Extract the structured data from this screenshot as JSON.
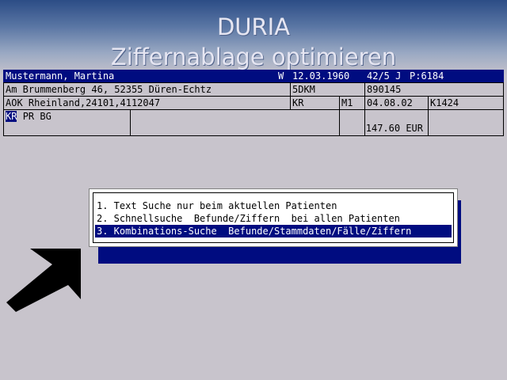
{
  "banner": {
    "app_name": "DURIA",
    "subtitle": "Ziffernablage optimieren"
  },
  "patient": {
    "name": "Mustermann, Martina",
    "sex": "W",
    "birthdate": "12.03.1960",
    "age": "42/5 J",
    "patient_no": "P:6184",
    "address": "Am Brummenberg 46, 52355 Düren-Echtz",
    "address_code": "5DKM",
    "address_no": "890145",
    "insurance": "AOK Rheinland,24101,4112047",
    "ins_type": "KR",
    "member": "M1",
    "date": "04.08.02",
    "doc_code": "K1424",
    "case_types": [
      "KR",
      "PR",
      "BG"
    ],
    "amount": "147.60 EUR"
  },
  "menu": {
    "items": [
      {
        "label": "1. Text Suche nur beim aktuellen Patienten",
        "selected": false
      },
      {
        "label": "2. Schnellsuche  Befunde/Ziffern  bei allen Patienten",
        "selected": false
      },
      {
        "label": "3. Kombinations-Suche  Befunde/Stammdaten/Fälle/Ziffern",
        "selected": true
      }
    ]
  },
  "colors": {
    "background": "#c8c4cc",
    "highlight": "#000c80",
    "banner_top": "#2c4d86"
  },
  "icons": {
    "pointer": "arrow-up-right-icon"
  }
}
